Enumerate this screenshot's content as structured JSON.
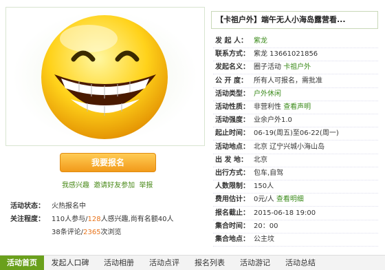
{
  "title": "【卡祖户外】端午无人小海岛露营看...",
  "signup_button": "我要报名",
  "actions": [
    "我感兴趣",
    "邀请好友参加",
    "举报"
  ],
  "status": {
    "label": "活动状态：",
    "value": "火热报名中"
  },
  "attention": {
    "label": "关注程度：",
    "line1_a": "110人参与/",
    "line1_b": "128",
    "line1_c": "人感兴趣,尚有名额40人",
    "line2_a": "38条评论/",
    "line2_b": "2365",
    "line2_c": "次浏览"
  },
  "details": [
    {
      "key": "发 起 人：",
      "value": "",
      "link": "紫龙"
    },
    {
      "key": "联系方式：",
      "value": "紫龙 13661021856",
      "link": ""
    },
    {
      "key": "发起名义：",
      "value": "圈子活动 ",
      "link": "卡祖户外"
    },
    {
      "key": "公 开 度：",
      "value": "所有人可报名，需批准",
      "link": ""
    },
    {
      "key": "活动类型：",
      "value": "",
      "link": "户外休闲"
    },
    {
      "key": "活动性质：",
      "value": "非营利性 ",
      "link": "查看声明"
    },
    {
      "key": "活动强度：",
      "value": "业余户外1.0",
      "link": ""
    },
    {
      "key": "起止时间：",
      "value": "06-19(周五)至06-22(周一)",
      "link": ""
    },
    {
      "key": "活动地点：",
      "value": "北京 辽宁兴城小海山岛",
      "link": ""
    },
    {
      "key": "出 发 地：",
      "value": "北京",
      "link": ""
    },
    {
      "key": "出行方式：",
      "value": "包车,自驾",
      "link": ""
    },
    {
      "key": "人数限制：",
      "value": "150人",
      "link": ""
    },
    {
      "key": "费用估计：",
      "value": "0元/人 ",
      "link": "查看明细"
    },
    {
      "key": "报名截止：",
      "value": "2015-06-18 19:00",
      "link": ""
    },
    {
      "key": "集合时间：",
      "value": "20：00",
      "link": ""
    },
    {
      "key": "集合地点：",
      "value": "公主坟",
      "link": ""
    }
  ],
  "tabs": [
    "活动首页",
    "发起人口碑",
    "活动相册",
    "活动点评",
    "报名列表",
    "活动游记",
    "活动总结"
  ],
  "colors": {
    "accent_green": "#6aa01c",
    "link_green": "#3a8a1a",
    "orange": "#e8731a",
    "button_orange": "#f29a1a"
  }
}
